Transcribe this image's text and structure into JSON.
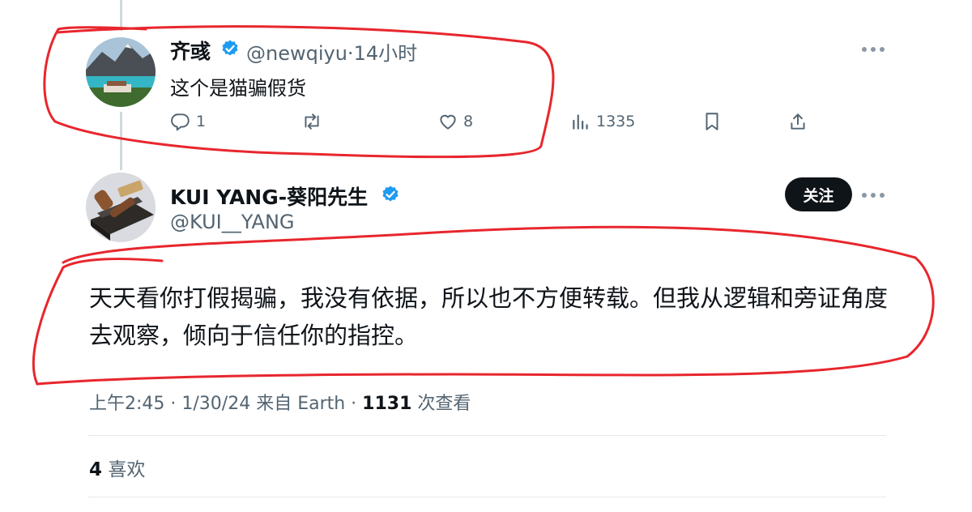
{
  "reply": {
    "author_name": "齐彧",
    "handle": "@newqiyu",
    "separator": "·",
    "time": "14小时",
    "text": "这个是猫骗假货",
    "actions": {
      "replies": "1",
      "likes": "8",
      "views": "1335"
    }
  },
  "main": {
    "author_name": "KUI YANG-葵阳先生",
    "handle": "@KUI__YANG",
    "follow_label": "关注",
    "text": "天天看你打假揭骗，我没有依据，所以也不方便转载。但我从逻辑和旁证角度去观察，倾向于信任你的指控。",
    "meta": {
      "time": "上午2:45",
      "sep1": " · ",
      "date": "1/30/24",
      "source": " 来自 Earth",
      "sep2": " · ",
      "views": "1131",
      "views_label": " 次查看"
    },
    "likes_count": "4",
    "likes_label": " 喜欢"
  },
  "colors": {
    "verified": "#1d9bf0",
    "annotation": "#e8262d",
    "secondary_text": "#536471"
  }
}
